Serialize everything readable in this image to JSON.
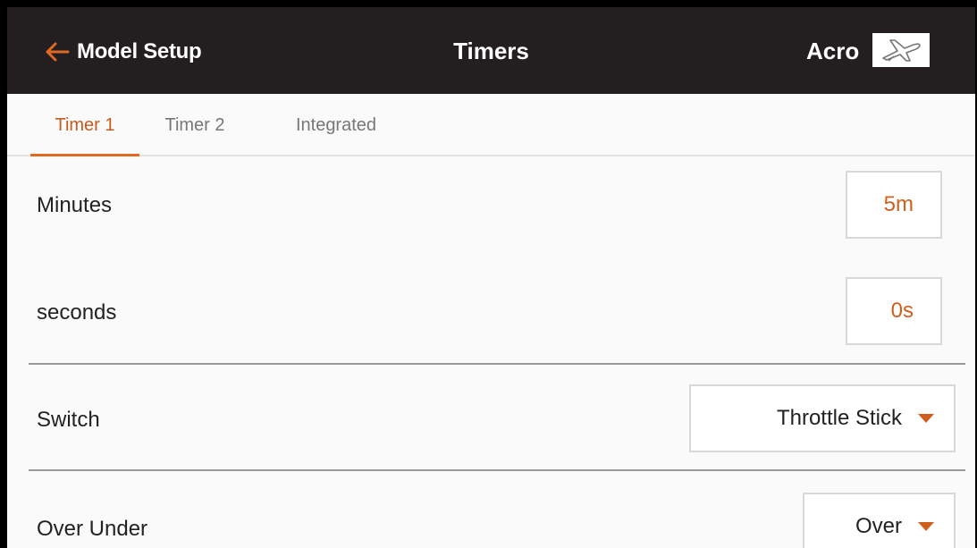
{
  "header": {
    "back_label": "Model Setup",
    "title": "Timers",
    "model_name": "Acro",
    "model_icon": "airplane-icon",
    "accent_color": "#e06a23",
    "bar_color": "#231f20"
  },
  "tabs": [
    {
      "label": "Timer 1",
      "active": true
    },
    {
      "label": "Timer 2",
      "active": false
    },
    {
      "label": "Integrated",
      "active": false
    }
  ],
  "settings": {
    "minutes": {
      "label": "Minutes",
      "value": "5m"
    },
    "seconds": {
      "label": "seconds",
      "value": "0s"
    },
    "switch": {
      "label": "Switch",
      "value": "Throttle Stick"
    },
    "over_under": {
      "label": "Over Under",
      "value": "Over"
    }
  }
}
